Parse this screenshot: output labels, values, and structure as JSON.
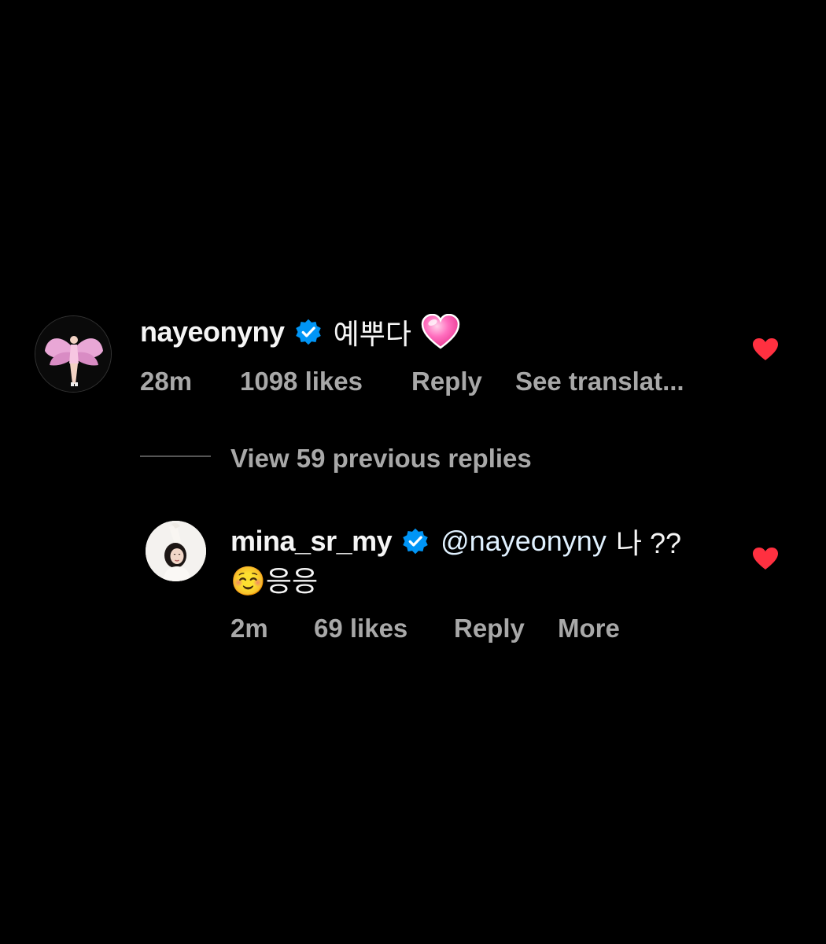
{
  "comments": [
    {
      "username": "nayeonyny",
      "verified": true,
      "text": "예뿌다",
      "emoji": "💗",
      "time": "28m",
      "likes": "1098 likes",
      "reply_label": "Reply",
      "extra_action": "See translat...",
      "liked": true
    },
    {
      "username": "mina_sr_my",
      "verified": true,
      "mention": "@nayeonyny",
      "text": "나 ??",
      "text_line2": "☺️응응",
      "time": "2m",
      "likes": "69 likes",
      "reply_label": "Reply",
      "extra_action": "More",
      "liked": true
    }
  ],
  "view_replies": "View 59 previous replies",
  "colors": {
    "background": "#000000",
    "text_primary": "#f5f5f5",
    "text_secondary": "#a8a8a8",
    "verified_blue": "#0095f6",
    "heart_red": "#ff3040"
  }
}
